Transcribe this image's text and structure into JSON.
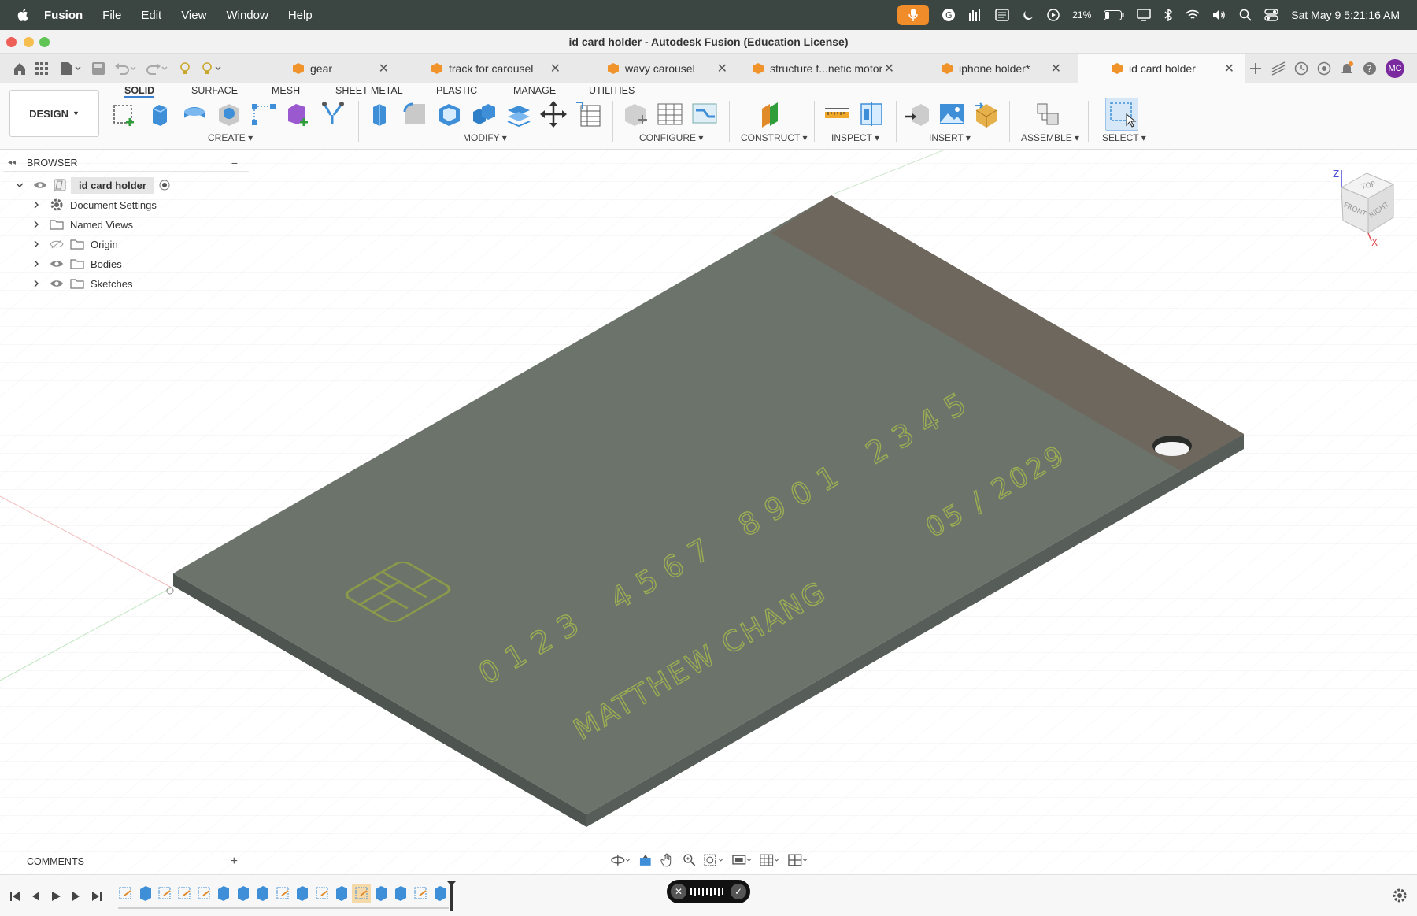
{
  "menubar": {
    "apple_icon": "apple-logo-icon",
    "items": [
      "Fusion",
      "File",
      "Edit",
      "View",
      "Window",
      "Help"
    ],
    "battery": "21%",
    "datetime": "Sat May 9  5:21:16 AM"
  },
  "window": {
    "title": "id card holder - Autodesk Fusion (Education License)"
  },
  "tabs": [
    {
      "label": "gear"
    },
    {
      "label": "track for carousel"
    },
    {
      "label": "wavy carousel"
    },
    {
      "label": "structure f...netic motor"
    },
    {
      "label": "iphone holder*"
    },
    {
      "label": "id card holder"
    }
  ],
  "avatar": "MC",
  "ribbon": {
    "design_label": "DESIGN",
    "tabs": [
      "SOLID",
      "SURFACE",
      "MESH",
      "SHEET METAL",
      "PLASTIC",
      "MANAGE",
      "UTILITIES"
    ],
    "groups": [
      "CREATE",
      "MODIFY",
      "CONFIGURE",
      "CONSTRUCT",
      "INSPECT",
      "INSERT",
      "ASSEMBLE",
      "SELECT"
    ]
  },
  "browser": {
    "title": "BROWSER",
    "root": "id card holder",
    "items": [
      "Document Settings",
      "Named Views",
      "Origin",
      "Bodies",
      "Sketches"
    ]
  },
  "comments": {
    "title": "COMMENTS"
  },
  "model": {
    "card_number": [
      "0123",
      "4567",
      "8901",
      "2345"
    ],
    "name": "MATTHEW CHANG",
    "expiry": "05 / 2029"
  },
  "viewcube": {
    "top": "TOP",
    "front": "FRONT",
    "right": "RIGHT",
    "axis_z": "Z",
    "axis_x": "X"
  },
  "colors": {
    "menubar": "#3b4541",
    "accent": "#f08c2a",
    "card_top": "#6b7269",
    "card_side": "#4f5450",
    "engrave": "#8a9a4a"
  }
}
